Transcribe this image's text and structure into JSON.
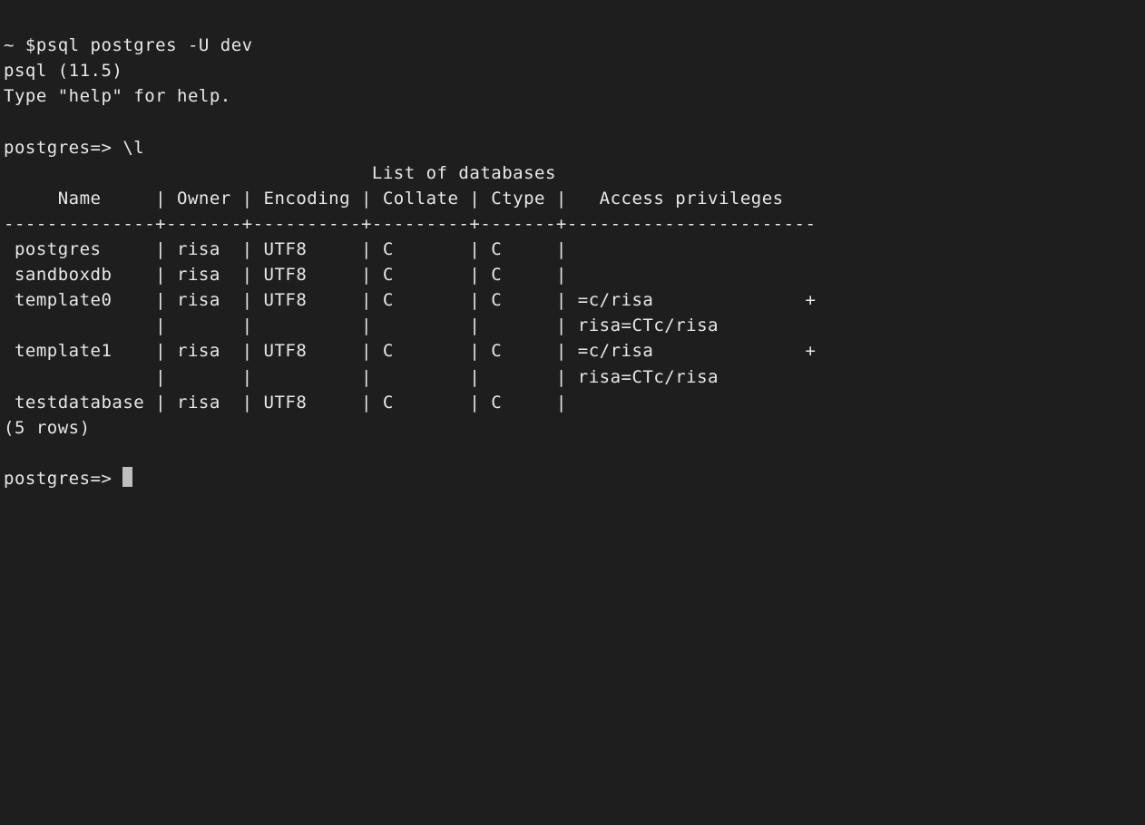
{
  "lines": {
    "l0": "~ $psql postgres -U dev",
    "l1": "psql (11.5)",
    "l2": "Type \"help\" for help.",
    "l3": "",
    "l4": "postgres=> \\l",
    "l5": "                                  List of databases",
    "l6": "     Name     | Owner | Encoding | Collate | Ctype |   Access privileges   ",
    "l7": "--------------+-------+----------+---------+-------+-----------------------",
    "l8": " postgres     | risa  | UTF8     | C       | C     | ",
    "l9": " sandboxdb    | risa  | UTF8     | C       | C     | ",
    "l10": " template0    | risa  | UTF8     | C       | C     | =c/risa              +",
    "l11": "              |       |          |         |       | risa=CTc/risa",
    "l12": " template1    | risa  | UTF8     | C       | C     | =c/risa              +",
    "l13": "              |       |          |         |       | risa=CTc/risa",
    "l14": " testdatabase | risa  | UTF8     | C       | C     | ",
    "l15": "(5 rows)",
    "l16": "",
    "l17": "postgres=> "
  },
  "command": {
    "prompt_shell": "~ $",
    "command_text": "psql postgres -U dev",
    "psql_version": "11.5",
    "help_hint": "Type \"help\" for help.",
    "psql_prompt": "postgres=>",
    "list_command": "\\l"
  },
  "table": {
    "title": "List of databases",
    "columns": [
      "Name",
      "Owner",
      "Encoding",
      "Collate",
      "Ctype",
      "Access privileges"
    ],
    "rows": [
      {
        "name": "postgres",
        "owner": "risa",
        "encoding": "UTF8",
        "collate": "C",
        "ctype": "C",
        "access": ""
      },
      {
        "name": "sandboxdb",
        "owner": "risa",
        "encoding": "UTF8",
        "collate": "C",
        "ctype": "C",
        "access": ""
      },
      {
        "name": "template0",
        "owner": "risa",
        "encoding": "UTF8",
        "collate": "C",
        "ctype": "C",
        "access": "=c/risa\nrisa=CTc/risa"
      },
      {
        "name": "template1",
        "owner": "risa",
        "encoding": "UTF8",
        "collate": "C",
        "ctype": "C",
        "access": "=c/risa\nrisa=CTc/risa"
      },
      {
        "name": "testdatabase",
        "owner": "risa",
        "encoding": "UTF8",
        "collate": "C",
        "ctype": "C",
        "access": ""
      }
    ],
    "row_count_text": "(5 rows)"
  }
}
